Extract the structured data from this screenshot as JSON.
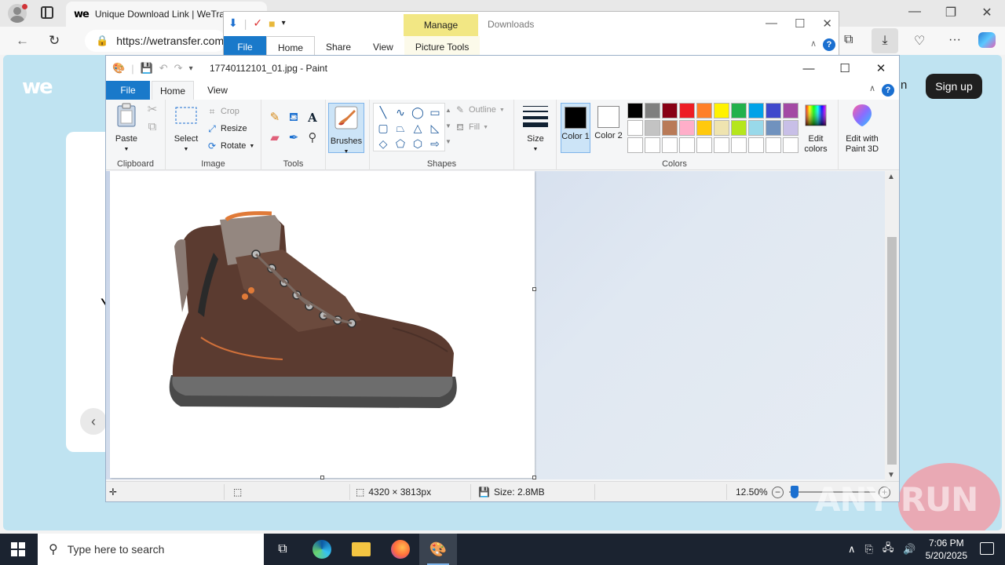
{
  "browser": {
    "tab_title": "Unique Download Link | WeTra",
    "tab_favicon": "we",
    "address": "https://wetransfer.com",
    "minimize": "—",
    "restore": "❐",
    "close": "✕"
  },
  "wetransfer": {
    "logo": "we",
    "signup_label": "Sign up",
    "login_partial": "n",
    "card_letter": "Y"
  },
  "explorer": {
    "manage_label": "Manage",
    "location": "Downloads",
    "tabs": {
      "file": "File",
      "home": "Home",
      "share": "Share",
      "view": "View",
      "picture_tools": "Picture Tools"
    },
    "help": "?"
  },
  "paint": {
    "title": "17740112101_01.jpg - Paint",
    "tabs": {
      "file": "File",
      "home": "Home",
      "view": "View"
    },
    "help": "?",
    "groups": {
      "clipboard": {
        "label": "Clipboard",
        "paste": "Paste"
      },
      "image": {
        "label": "Image",
        "select": "Select",
        "crop": "Crop",
        "resize": "Resize",
        "rotate": "Rotate"
      },
      "tools": {
        "label": "Tools"
      },
      "brushes": {
        "label": "Brushes"
      },
      "shapes": {
        "label": "Shapes",
        "outline": "Outline",
        "fill": "Fill"
      },
      "size": {
        "label": "Size"
      },
      "colors": {
        "label": "Colors",
        "color1": "Color 1",
        "color2": "Color 2",
        "edit_colors": "Edit colors",
        "palette_row1": [
          "#000000",
          "#7f7f7f",
          "#880015",
          "#ed1c24",
          "#ff7f27",
          "#fff200",
          "#22b14c",
          "#00a2e8",
          "#3f48cc",
          "#a349a4"
        ],
        "palette_row2": [
          "#ffffff",
          "#c3c3c3",
          "#b97a57",
          "#ffaec9",
          "#ffc90e",
          "#efe4b0",
          "#b5e61d",
          "#99d9ea",
          "#7092be",
          "#c8bfe7"
        ]
      },
      "paint3d": {
        "label": "Edit with Paint 3D"
      }
    },
    "status": {
      "dimensions": "4320 × 3813px",
      "size": "Size: 2.8MB",
      "zoom": "12.50%"
    }
  },
  "watermark": "ANY RUN",
  "taskbar": {
    "search_placeholder": "Type here to search",
    "time": "7:06 PM",
    "date": "5/20/2025"
  }
}
